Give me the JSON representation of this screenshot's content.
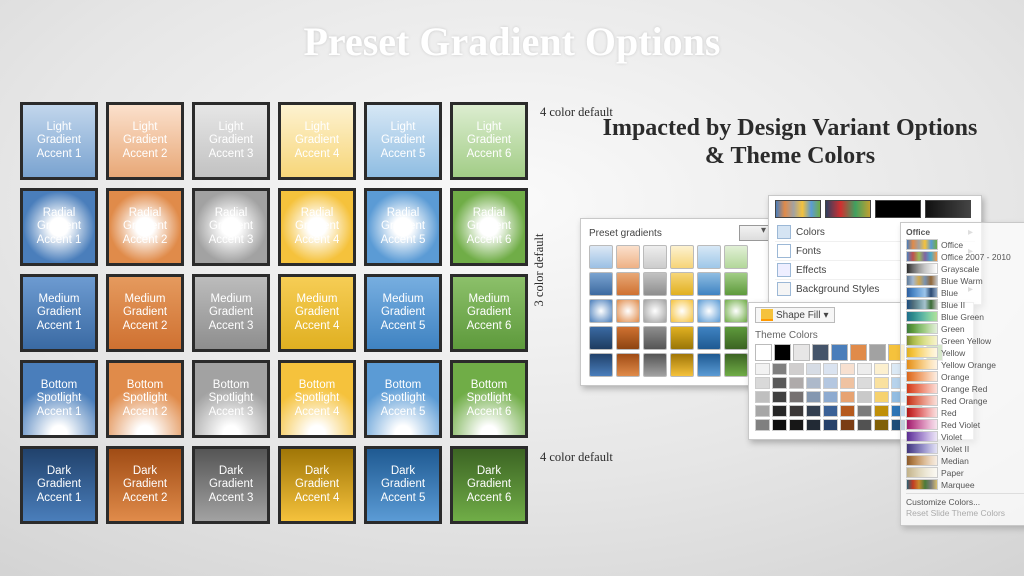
{
  "title": "Preset Gradient Options",
  "subtitle": "Impacted by Design Variant Options & Theme Colors",
  "annotations": {
    "row1": "4 color default",
    "rows234": "3 color default",
    "row5": "4 color default"
  },
  "accent_colors": {
    "accent1": "#4a7ebb",
    "accent2": "#e08b4a",
    "accent3": "#a2a2a2",
    "accent4": "#f5c23c",
    "accent5": "#5b9bd5",
    "accent6": "#70ad47"
  },
  "grid": {
    "rows": [
      {
        "type": "light",
        "label_prefix": "Light Gradient Accent"
      },
      {
        "type": "spot",
        "label_prefix": "Radial Gradient Accent"
      },
      {
        "type": "med",
        "label_prefix": "Medium Gradient Accent"
      },
      {
        "type": "bot",
        "label_prefix": "Bottom Spotlight Accent"
      },
      {
        "type": "dark",
        "label_prefix": "Dark Gradient Accent"
      }
    ],
    "labels": {
      "light": [
        "Light Gradient Accent 1",
        "Light Gradient Accent 2",
        "Light Gradient Accent 3",
        "Light Gradient Accent 4",
        "Light Gradient Accent 5",
        "Light Gradient Accent 6"
      ],
      "spot": [
        "Radial Gradient Accent 1",
        "Radial Gradient Accent 2",
        "Radial Gradient Accent 3",
        "Radial Gradient Accent 4",
        "Radial Gradient Accent 5",
        "Radial Gradient Accent 6"
      ],
      "med": [
        "Medium Gradient Accent 1",
        "Medium Gradient Accent 2",
        "Medium Gradient Accent 3",
        "Medium Gradient Accent 4",
        "Medium Gradient Accent 5",
        "Medium Gradient Accent 6"
      ],
      "bot": [
        "Bottom Spotlight Accent 1",
        "Bottom Spotlight Accent 2",
        "Bottom Spotlight Accent 3",
        "Bottom Spotlight Accent 4",
        "Bottom Spotlight Accent 5",
        "Bottom Spotlight Accent 6"
      ],
      "dark": [
        "Dark Gradient Accent 1",
        "Dark Gradient Accent 2",
        "Dark Gradient Accent 3",
        "Dark Gradient Accent 4",
        "Dark Gradient Accent 5",
        "Dark Gradient Accent 6"
      ]
    }
  },
  "preset_panel": {
    "header": "Preset gradients"
  },
  "variant_menu": {
    "items": [
      "Colors",
      "Fonts",
      "Effects",
      "Background Styles"
    ]
  },
  "shape_fill": {
    "button": "Shape Fill",
    "section": "Theme Colors"
  },
  "color_themes": {
    "header": "Office",
    "items": [
      "Office",
      "Office 2007 - 2010",
      "Grayscale",
      "Blue Warm",
      "Blue",
      "Blue II",
      "Blue Green",
      "Green",
      "Green Yellow",
      "Yellow",
      "Yellow Orange",
      "Orange",
      "Orange Red",
      "Red Orange",
      "Red",
      "Red Violet",
      "Violet",
      "Violet II",
      "Median",
      "Paper",
      "Marquee"
    ],
    "footer1": "Customize Colors...",
    "footer2": "Reset Slide Theme Colors"
  }
}
